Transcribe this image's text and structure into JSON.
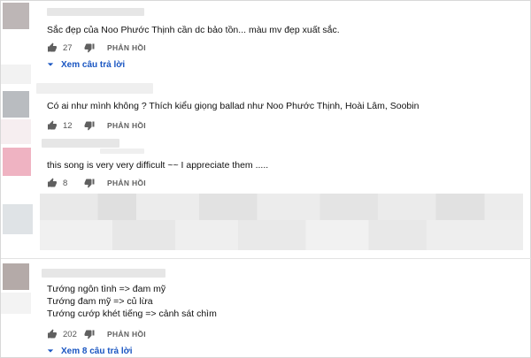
{
  "comments": [
    {
      "text_lines": [
        "Sắc đẹp của Noo Phước Thịnh cần dc bảo tồn... màu mv đẹp xuất sắc."
      ],
      "likes": "27",
      "reply_label": "PHẢN HỒI",
      "view_replies": "Xem câu trả lời"
    },
    {
      "text_lines": [
        "Có ai như mình không ?  Thích kiểu giọng ballad như Noo Phước Thịnh,  Hoài Lâm,  Soobin"
      ],
      "likes": "12",
      "reply_label": "PHẢN HỒI"
    },
    {
      "text_lines": [
        "this song is very very difficult ~~ I appreciate them ....."
      ],
      "likes": "8",
      "reply_label": "PHẢN HỒI"
    },
    {
      "text_lines": [
        "Tướng ngôn tình => đam mỹ",
        "Tướng đam mỹ => củ lừa",
        "Tướng cướp khét tiếng => cảnh sát chìm"
      ],
      "likes": "202",
      "reply_label": "PHẢN HỒI",
      "view_replies": "Xem 8 câu trả lời"
    }
  ],
  "colors": {
    "link_blue": "#1a56c2",
    "avatar_1": "#bdb6b6",
    "avatar_2": "#b9bcc0",
    "avatar_3": "#efb3c2",
    "avatar_4": "#b4aaa8"
  }
}
